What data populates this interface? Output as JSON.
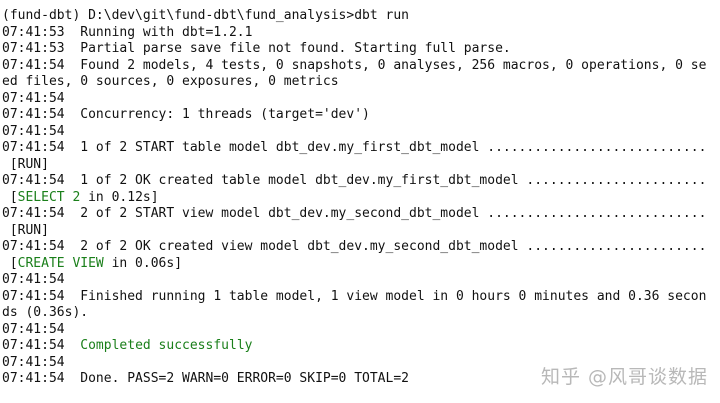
{
  "terminal": {
    "lines": [
      "(fund-dbt) D:\\dev\\git\\fund-dbt\\fund_analysis>dbt run",
      "07:41:53  Running with dbt=1.2.1",
      "07:41:53  Partial parse save file not found. Starting full parse.",
      "07:41:54  Found 2 models, 4 tests, 0 snapshots, 0 analyses, 256 macros, 0 operations, 0 se",
      "ed files, 0 sources, 0 exposures, 0 metrics",
      "07:41:54",
      "07:41:54  Concurrency: 1 threads (target='dev')",
      "07:41:54",
      "07:41:54  1 of 2 START table model dbt_dev.my_first_dbt_model ............................",
      " [RUN]",
      "07:41:54  1 of 2 OK created table model dbt_dev.my_first_dbt_model .......................",
      " [",
      "07:41:54  2 of 2 START view model dbt_dev.my_second_dbt_model ............................",
      " [RUN]",
      "07:41:54  2 of 2 OK created view model dbt_dev.my_second_dbt_model .......................",
      " [",
      "07:41:54",
      "07:41:54  Finished running 1 table model, 1 view model in 0 hours 0 minutes and 0.36 secon",
      "ds (0.36s).",
      "07:41:54",
      "07:41:54  ",
      "07:41:54",
      "07:41:54  Done. PASS=2 WARN=0 ERROR=0 SKIP=0 TOTAL=2"
    ],
    "select_status": "SELECT 2",
    "select_tail": " in 0.12s]",
    "create_status": "CREATE VIEW",
    "create_tail": " in 0.06s]",
    "completed": "Completed successfully"
  },
  "watermark": "知乎 @风哥谈数据",
  "colors": {
    "background": "#ffffff",
    "text": "#111111",
    "success": "#1a7f1a",
    "watermark": "#b8b8b8"
  }
}
